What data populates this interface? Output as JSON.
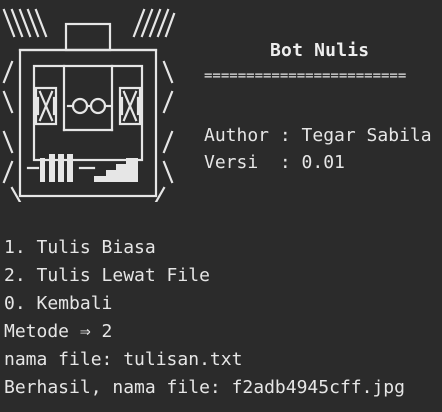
{
  "window": {
    "background": "#2b2b2b",
    "foreground": "#e6e6e6"
  },
  "header": {
    "title": "Bot Nulis",
    "separator": "========================",
    "author_line": "Author : Tegar Sabila",
    "version_line": "Versi  : 0.01"
  },
  "logo": {
    "icon": "robot-ascii-art-icon"
  },
  "menu": {
    "items": [
      "1. Tulis Biasa",
      "2. Tulis Lewat File",
      "0. Kembali"
    ]
  },
  "session": {
    "method_line": "Metode ⇒ 2",
    "filename_line": "nama file: tulisan.txt",
    "result_line": "Berhasil, nama file: f2adb4945cff.jpg"
  }
}
